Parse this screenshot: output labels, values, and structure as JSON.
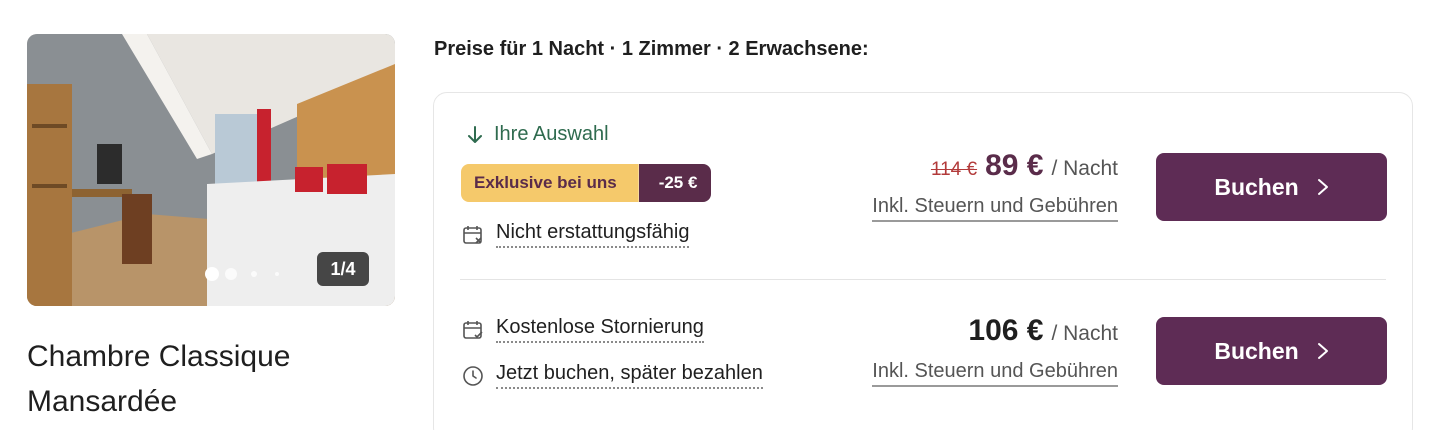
{
  "room": {
    "title": "Chambre Classique Mansardée",
    "photo_counter": "1/4"
  },
  "header": {
    "prices_for": "Preise für 1 Nacht · 1 Zimmer · 2 Erwachsene:"
  },
  "offers": [
    {
      "label": "Ihre Auswahl",
      "badge_text": "Exklusive bei uns",
      "badge_discount": "-25 €",
      "features": [
        "Nicht erstattungsfähig"
      ],
      "old_price": "114 €",
      "price": "89 €",
      "per_night": "/ Nacht",
      "taxes": "Inkl. Steuern und Gebühren",
      "button": "Buchen"
    },
    {
      "features": [
        "Kostenlose Stornierung",
        "Jetzt buchen, später bezahlen"
      ],
      "price": "106 €",
      "per_night": "/ Nacht",
      "taxes": "Inkl. Steuern und Gebühren",
      "button": "Buchen"
    }
  ],
  "colors": {
    "brand": "#5e2c55",
    "badge_yellow": "#f5c96b",
    "choice_green": "#2f6b4f",
    "old_price_red": "#b23a3a"
  },
  "icons": [
    "arrow-down-icon",
    "calendar-x-icon",
    "calendar-check-icon",
    "clock-icon",
    "chevron-right-icon"
  ]
}
